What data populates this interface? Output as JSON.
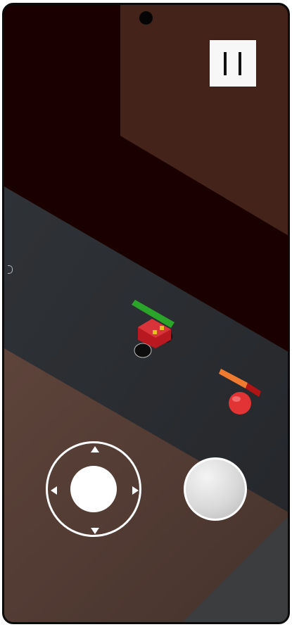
{
  "game": {
    "scene": "isometric arena",
    "colors": {
      "background": "#1b0000",
      "wall": "#43231a",
      "floor": "#2c2e32",
      "lower_floor": "#5a4038",
      "player_body": "#c8222a",
      "player_health": "#2aa52a",
      "enemy_body": "#e83a3a",
      "enemy_health": "#f07a30",
      "enemy_health_lost": "#b01414"
    },
    "player": {
      "health_fraction": 1.0
    },
    "enemy": {
      "health_fraction": 0.6
    }
  },
  "controls": {
    "pause_icon": "pause-icon",
    "joystick_icon": "joystick-icon",
    "action_icon": "action-circle-icon"
  }
}
